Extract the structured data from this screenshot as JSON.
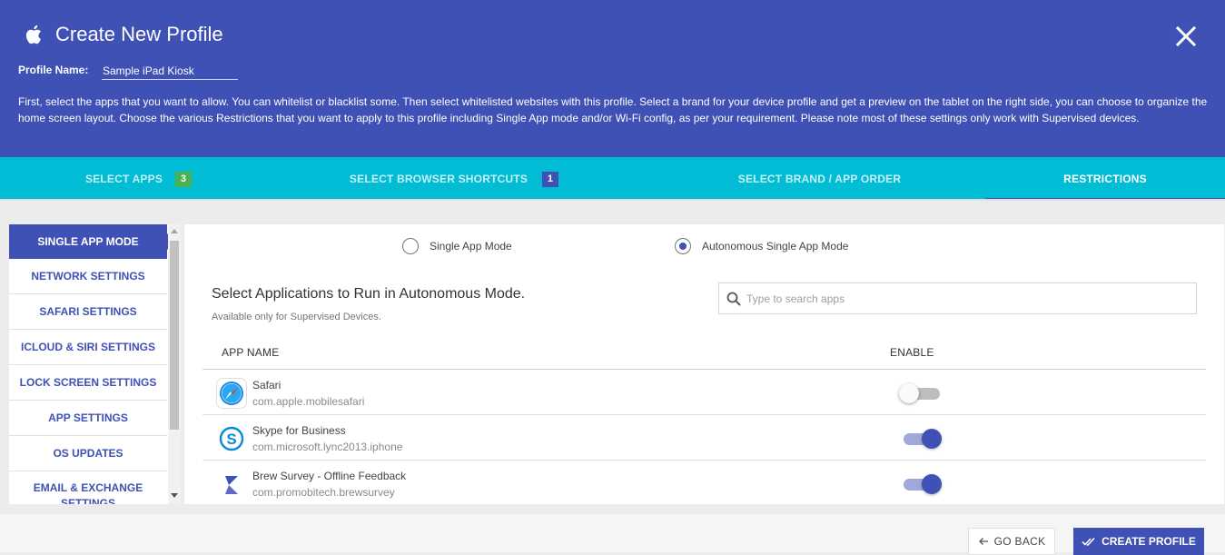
{
  "header": {
    "title": "Create New Profile",
    "profile_name_label": "Profile Name:",
    "profile_name_value": "Sample iPad Kiosk",
    "description": "First, select the apps that you want to allow. You can whitelist or blacklist some. Then select whitelisted websites with this profile. Select a brand for your device profile and get a preview on the tablet on the right side, you can choose to organize the home screen layout. Choose the various Restrictions that you want to apply to this profile including Single App mode and/or Wi-Fi config, as per your requirement. Please note most of these settings only work with Supervised devices."
  },
  "tabs": [
    {
      "label": "SELECT APPS",
      "badge": "3"
    },
    {
      "label": "SELECT BROWSER SHORTCUTS",
      "badge": "1"
    },
    {
      "label": "SELECT BRAND / APP ORDER"
    },
    {
      "label": "RESTRICTIONS"
    }
  ],
  "sidebar": {
    "items": [
      {
        "label": "SINGLE APP MODE"
      },
      {
        "label": "NETWORK SETTINGS"
      },
      {
        "label": "SAFARI SETTINGS"
      },
      {
        "label": "ICLOUD & SIRI SETTINGS"
      },
      {
        "label": "LOCK SCREEN SETTINGS"
      },
      {
        "label": "APP SETTINGS"
      },
      {
        "label": "OS UPDATES"
      },
      {
        "label": "EMAIL & EXCHANGE SETTINGS"
      }
    ]
  },
  "mode": {
    "options": [
      {
        "label": "Single App Mode",
        "selected": false
      },
      {
        "label": "Autonomous Single App Mode",
        "selected": true
      }
    ]
  },
  "section": {
    "title": "Select Applications to Run in Autonomous Mode.",
    "subtitle": "Available only for Supervised Devices.",
    "search_placeholder": "Type to search apps"
  },
  "table": {
    "columns": [
      "APP NAME",
      "ENABLE"
    ],
    "rows": [
      {
        "name": "Safari",
        "bundle_id": "com.apple.mobilesafari",
        "enabled": false,
        "icon": "safari-icon"
      },
      {
        "name": "Skype for Business",
        "bundle_id": "com.microsoft.lync2013.iphone",
        "enabled": true,
        "icon": "skype-icon"
      },
      {
        "name": "Brew Survey - Offline Feedback",
        "bundle_id": "com.promobitech.brewsurvey",
        "enabled": true,
        "icon": "brew-survey-icon"
      }
    ]
  },
  "footer": {
    "back_label": "GO BACK",
    "create_label": "CREATE PROFILE"
  },
  "colors": {
    "primary": "#3f51b5",
    "tab_bar": "#00bcd4",
    "badge_green": "#4caf50"
  }
}
